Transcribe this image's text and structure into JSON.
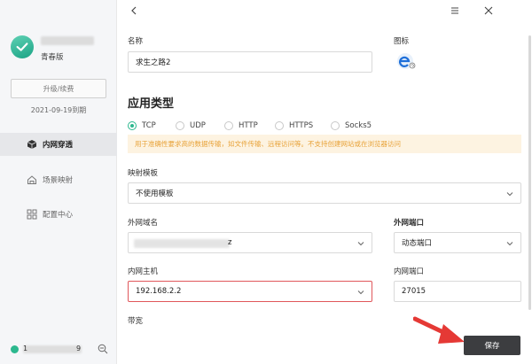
{
  "sidebar": {
    "edition": "青春版",
    "upgrade_label": "升级/续费",
    "expire_date": "2021-09-19到期",
    "nav": [
      {
        "label": "内网穿透",
        "icon": "cube-icon",
        "active": true
      },
      {
        "label": "场景映射",
        "icon": "home-icon",
        "active": false
      },
      {
        "label": "配置中心",
        "icon": "grid-icon",
        "active": false
      }
    ],
    "footer": {
      "digit_start": "1",
      "digit_end": "9",
      "zoom_icon": "zoom-out-icon"
    }
  },
  "header": {
    "back_icon": "chevron-left-icon",
    "menu_icon": "menu-icon",
    "close_icon": "close-icon"
  },
  "form": {
    "name_label": "名称",
    "name_value": "求生之路2",
    "icon_label": "图标",
    "app_type_title": "应用类型",
    "protocols": [
      "TCP",
      "UDP",
      "HTTP",
      "HTTPS",
      "Socks5"
    ],
    "selected_protocol": "TCP",
    "notice": "用于准确性要求高的数据传输，如文件传输、远程访问等。不支持创建网站或在浏览器访问",
    "template_label": "映射模板",
    "template_value": "不使用模板",
    "ext_domain_label": "外网域名",
    "ext_domain_suffix": "z",
    "ext_port_label": "外网端口",
    "ext_port_value": "动态端口",
    "int_host_label": "内网主机",
    "int_host_value": "192.168.2.2",
    "int_port_label": "内网端口",
    "int_port_value": "27015",
    "bandwidth_label": "带宽",
    "save_label": "保存"
  },
  "colors": {
    "accent": "#2cb88e",
    "notice_text": "#e8a33a",
    "notice_bg": "#fdf3e1",
    "error_border": "#e0575b",
    "save_bg": "#3c3d40",
    "arrow": "#e53935"
  }
}
